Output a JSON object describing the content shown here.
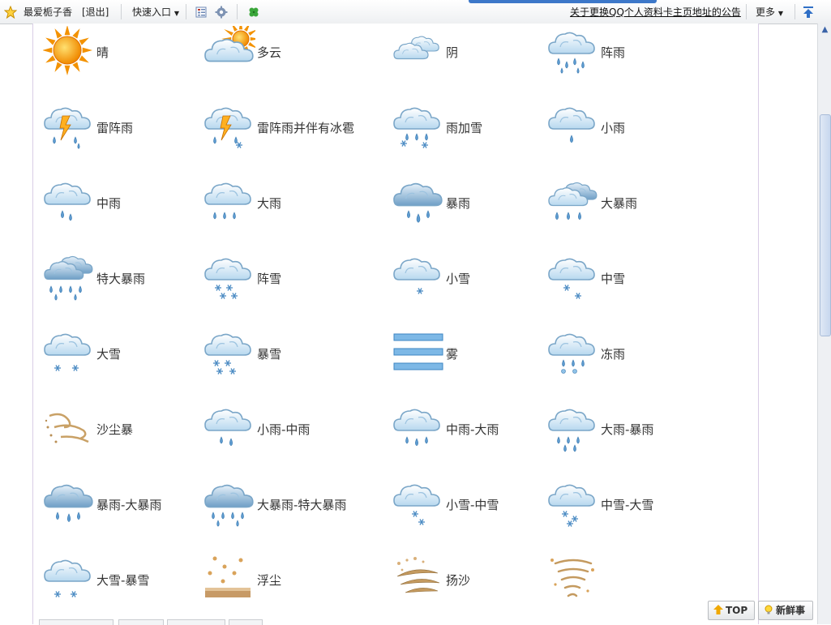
{
  "toolbar": {
    "username": "最爱栀子香",
    "logout": "[退出]",
    "quick_entry": "快速入口",
    "notice": "关于更换QQ个人资料卡主页地址的公告",
    "more": "更多"
  },
  "weather_items": [
    {
      "label": "晴",
      "icon": "sun-icon"
    },
    {
      "label": "多云",
      "icon": "cloudy-icon"
    },
    {
      "label": "阴",
      "icon": "overcast-icon"
    },
    {
      "label": "阵雨",
      "icon": "shower-icon"
    },
    {
      "label": "雷阵雨",
      "icon": "thunderstorm-icon"
    },
    {
      "label": "雷阵雨并伴有冰雹",
      "icon": "thunderstorm-hail-icon"
    },
    {
      "label": "雨加雪",
      "icon": "sleet-icon"
    },
    {
      "label": "小雨",
      "icon": "light-rain-icon"
    },
    {
      "label": "中雨",
      "icon": "moderate-rain-icon"
    },
    {
      "label": "大雨",
      "icon": "heavy-rain-icon"
    },
    {
      "label": "暴雨",
      "icon": "rainstorm-icon"
    },
    {
      "label": "大暴雨",
      "icon": "heavy-rainstorm-icon"
    },
    {
      "label": "特大暴雨",
      "icon": "extreme-rainstorm-icon"
    },
    {
      "label": "阵雪",
      "icon": "snow-shower-icon"
    },
    {
      "label": "小雪",
      "icon": "light-snow-icon"
    },
    {
      "label": "中雪",
      "icon": "moderate-snow-icon"
    },
    {
      "label": "大雪",
      "icon": "heavy-snow-icon"
    },
    {
      "label": "暴雪",
      "icon": "snowstorm-icon"
    },
    {
      "label": "雾",
      "icon": "fog-icon"
    },
    {
      "label": "冻雨",
      "icon": "freezing-rain-icon"
    },
    {
      "label": "沙尘暴",
      "icon": "sandstorm-icon"
    },
    {
      "label": "小雨-中雨",
      "icon": "light-to-moderate-rain-icon"
    },
    {
      "label": "中雨-大雨",
      "icon": "moderate-to-heavy-rain-icon"
    },
    {
      "label": "大雨-暴雨",
      "icon": "heavy-rain-to-rainstorm-icon"
    },
    {
      "label": "暴雨-大暴雨",
      "icon": "rainstorm-to-heavy-rainstorm-icon"
    },
    {
      "label": "大暴雨-特大暴雨",
      "icon": "heavy-to-extreme-rainstorm-icon"
    },
    {
      "label": "小雪-中雪",
      "icon": "light-to-moderate-snow-icon"
    },
    {
      "label": "中雪-大雪",
      "icon": "moderate-to-heavy-snow-icon"
    },
    {
      "label": "大雪-暴雪",
      "icon": "heavy-snow-to-snowstorm-icon"
    },
    {
      "label": "浮尘",
      "icon": "floating-dust-icon"
    },
    {
      "label": "扬沙",
      "icon": "blowing-sand-icon"
    },
    {
      "label": "",
      "icon": "tornado-icon"
    }
  ],
  "buttons": {
    "top": "TOP",
    "news": "新鲜事"
  },
  "colors": {
    "accent": "#3d78c9",
    "cloud": "#cfe6f7",
    "rain": "#6fa9d6",
    "sun": "#f5a623",
    "sand": "#c49a5f"
  }
}
